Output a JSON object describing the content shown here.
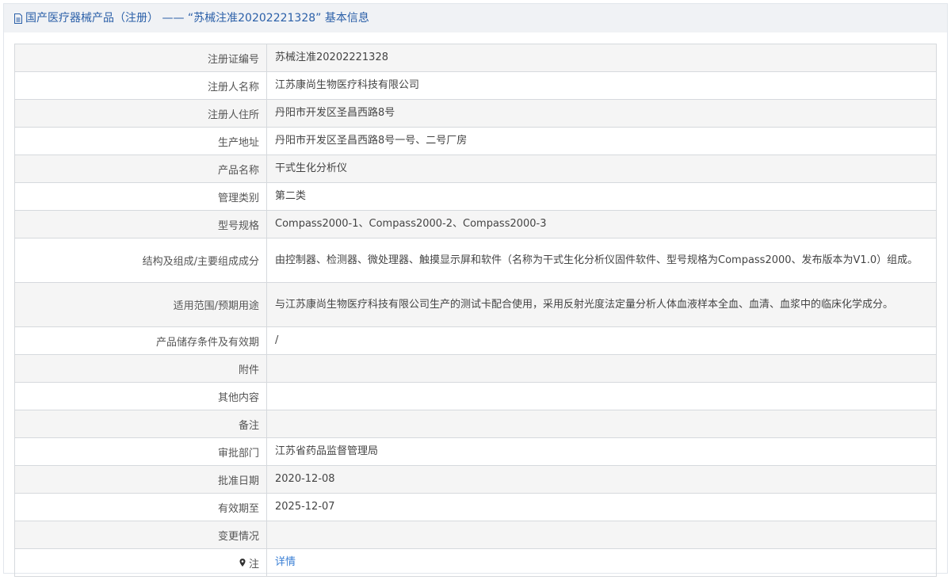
{
  "header": {
    "title": "国产医疗器械产品（注册） —— “苏械注准20202221328” 基本信息"
  },
  "rows": [
    {
      "label": "注册证编号",
      "value": "苏械注准20202221328"
    },
    {
      "label": "注册人名称",
      "value": "江苏康尚生物医疗科技有限公司"
    },
    {
      "label": "注册人住所",
      "value": "丹阳市开发区圣昌西路8号"
    },
    {
      "label": "生产地址",
      "value": "丹阳市开发区圣昌西路8号一号、二号厂房"
    },
    {
      "label": "产品名称",
      "value": "干式生化分析仪"
    },
    {
      "label": "管理类别",
      "value": "第二类"
    },
    {
      "label": "型号规格",
      "value": "Compass2000-1、Compass2000-2、Compass2000-3"
    },
    {
      "label": "结构及组成/主要组成成分",
      "value": "由控制器、检测器、微处理器、触摸显示屏和软件（名称为干式生化分析仪固件软件、型号规格为Compass2000、发布版本为V1.0）组成。"
    },
    {
      "label": "适用范围/预期用途",
      "value": "与江苏康尚生物医疗科技有限公司生产的测试卡配合使用，采用反射光度法定量分析人体血液样本全血、血清、血浆中的临床化学成分。"
    },
    {
      "label": "产品储存条件及有效期",
      "value": "/"
    },
    {
      "label": "附件",
      "value": ""
    },
    {
      "label": "其他内容",
      "value": ""
    },
    {
      "label": "备注",
      "value": ""
    },
    {
      "label": "审批部门",
      "value": "江苏省药品监督管理局"
    },
    {
      "label": "批准日期",
      "value": "2020-12-08"
    },
    {
      "label": "有效期至",
      "value": "2025-12-07"
    },
    {
      "label": "变更情况",
      "value": ""
    }
  ],
  "note_row": {
    "label": "注",
    "link_text": "详情"
  }
}
